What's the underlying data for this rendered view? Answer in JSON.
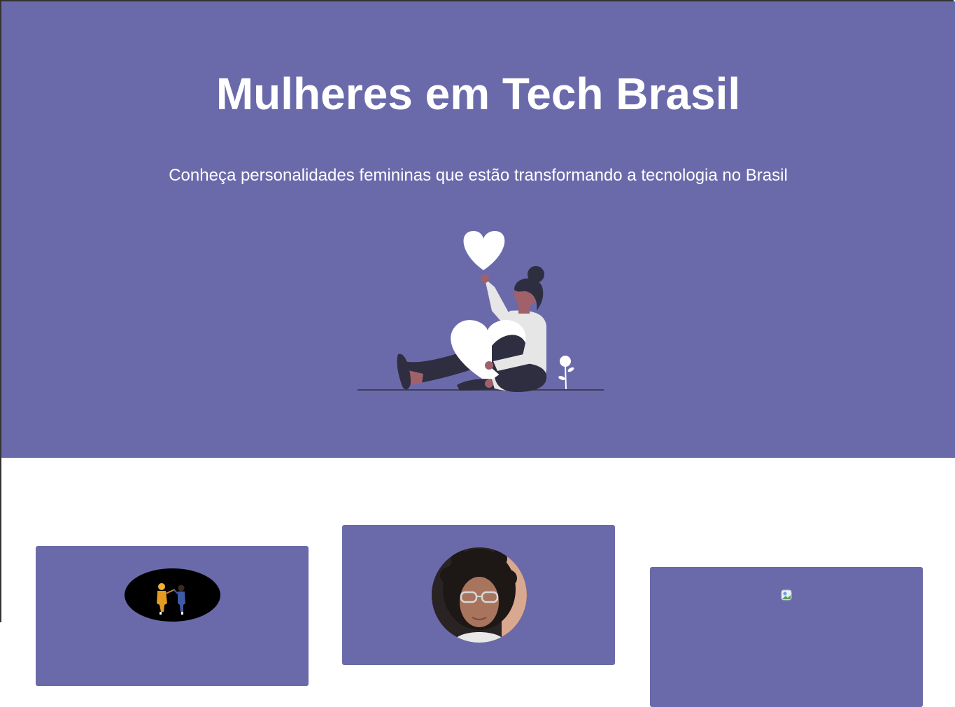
{
  "hero": {
    "title": "Mulheres em Tech Brasil",
    "subtitle": "Conheça personalidades femininas que estão transformando a tecnologia no Brasil",
    "illustration_icon": "woman-sitting-with-hearts-illustration"
  },
  "cards": [
    {
      "image_icon": "two-people-silhouette-image"
    },
    {
      "image_icon": "woman-portrait-photo"
    },
    {
      "image_icon": "broken-image-icon"
    }
  ],
  "colors": {
    "hero_background": "#6a6aab",
    "card_background": "#6a6aab",
    "title_text": "#ffffff",
    "page_background": "#ffffff"
  }
}
